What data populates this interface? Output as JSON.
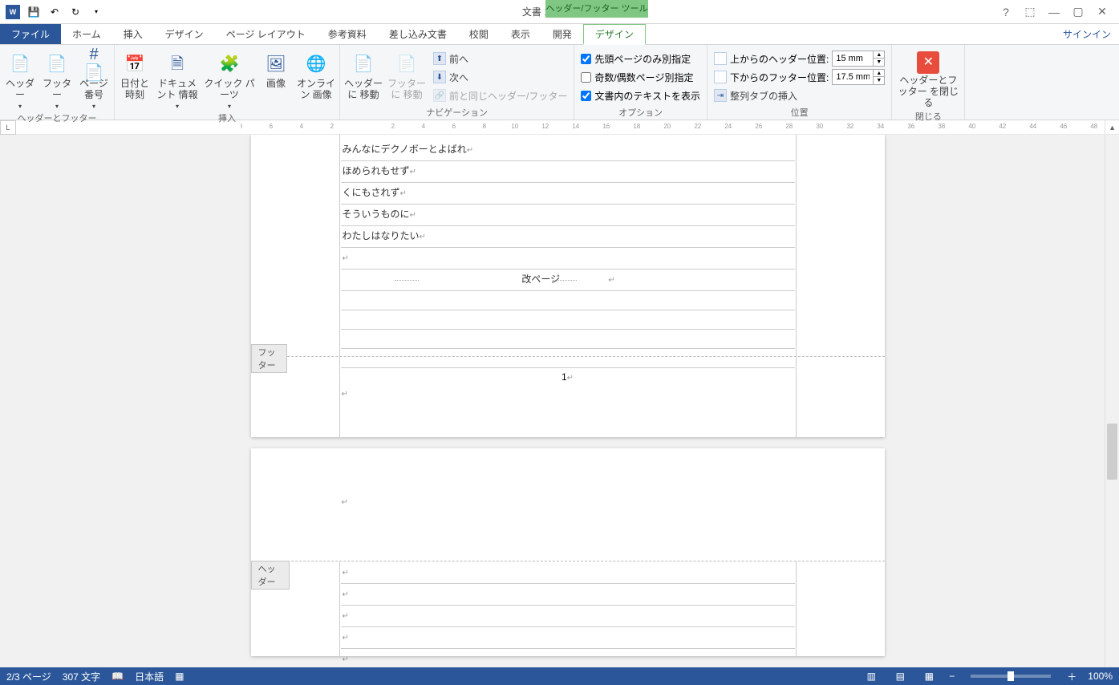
{
  "app": {
    "title": "文書 1 - Word",
    "context_tab": "ヘッダー/フッター ツール",
    "signin": "サインイン"
  },
  "tabs": [
    "ファイル",
    "ホーム",
    "挿入",
    "デザイン",
    "ページ レイアウト",
    "参考資料",
    "差し込み文書",
    "校閲",
    "表示",
    "開発",
    "デザイン"
  ],
  "ribbon": {
    "g1": {
      "label": "ヘッダーとフッター",
      "header": "ヘッダー",
      "footer": "フッター",
      "pagenum": "ページ\n番号"
    },
    "g2": {
      "label": "挿入",
      "datetime": "日付と\n時刻",
      "docinfo": "ドキュメント\n情報",
      "quickparts": "クイック パーツ",
      "picture": "画像",
      "online": "オンライン\n画像"
    },
    "g3": {
      "label": "ナビゲーション",
      "gotoHeader": "ヘッダーに\n移動",
      "gotoFooter": "フッターに\n移動",
      "prev": "前へ",
      "next": "次へ",
      "link": "前と同じヘッダー/フッター"
    },
    "g4": {
      "label": "オプション",
      "firstPage": "先頭ページのみ別指定",
      "oddEven": "奇数/偶数ページ別指定",
      "showDoc": "文書内のテキストを表示",
      "checked_first": true,
      "checked_odd": false,
      "checked_show": true
    },
    "g5": {
      "label": "位置",
      "headerPos": "上からのヘッダー位置:",
      "footerPos": "下からのフッター位置:",
      "alignTab": "整列タブの挿入",
      "headerVal": "15 mm",
      "footerVal": "17.5 mm"
    },
    "g6": {
      "label": "閉じる",
      "close": "ヘッダーとフッター\nを閉じる"
    }
  },
  "ruler_marks": [
    "8",
    "6",
    "4",
    "2",
    "",
    "2",
    "4",
    "6",
    "8",
    "10",
    "12",
    "14",
    "16",
    "18",
    "20",
    "22",
    "24",
    "26",
    "28",
    "30",
    "32",
    "34",
    "36",
    "38",
    "40",
    "42",
    "44",
    "46",
    "48"
  ],
  "doc": {
    "footer_tag": "フッター",
    "header_tag": "ヘッダー",
    "lines": [
      "みんなにデクノボーとよばれ",
      "ほめられもせず",
      "くにもされず",
      "そういうものに",
      "わたしはなりたい"
    ],
    "page_break": "改ページ",
    "page_number": "1"
  },
  "status": {
    "page": "2/3 ページ",
    "words": "307 文字",
    "lang": "日本語",
    "zoom": "100%"
  }
}
